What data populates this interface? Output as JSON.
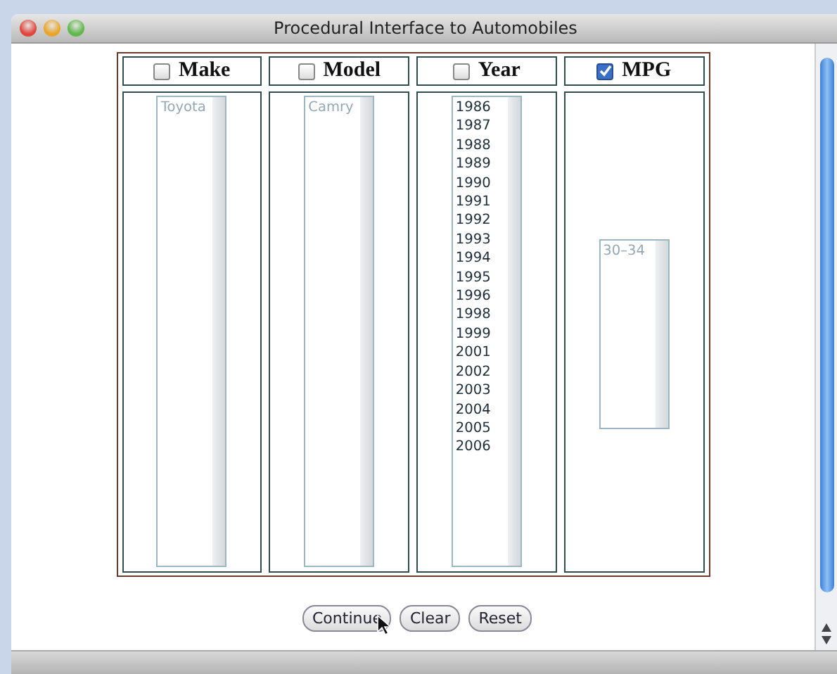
{
  "window": {
    "title": "Procedural Interface to Automobiles"
  },
  "columns": [
    {
      "label": "Make",
      "checked": false,
      "kind": "full",
      "disabled": true,
      "options": [
        "Toyota"
      ]
    },
    {
      "label": "Model",
      "checked": false,
      "kind": "full",
      "disabled": true,
      "options": [
        "Camry"
      ]
    },
    {
      "label": "Year",
      "checked": false,
      "kind": "full",
      "disabled": false,
      "options": [
        "1986",
        "1987",
        "1988",
        "1989",
        "1990",
        "1991",
        "1992",
        "1993",
        "1994",
        "1995",
        "1996",
        "1998",
        "1999",
        "2001",
        "2002",
        "2003",
        "2004",
        "2005",
        "2006"
      ]
    },
    {
      "label": "MPG",
      "checked": true,
      "kind": "compact",
      "disabled": true,
      "options": [
        "30–34"
      ]
    }
  ],
  "buttons": [
    "Continue",
    "Clear",
    "Reset"
  ]
}
